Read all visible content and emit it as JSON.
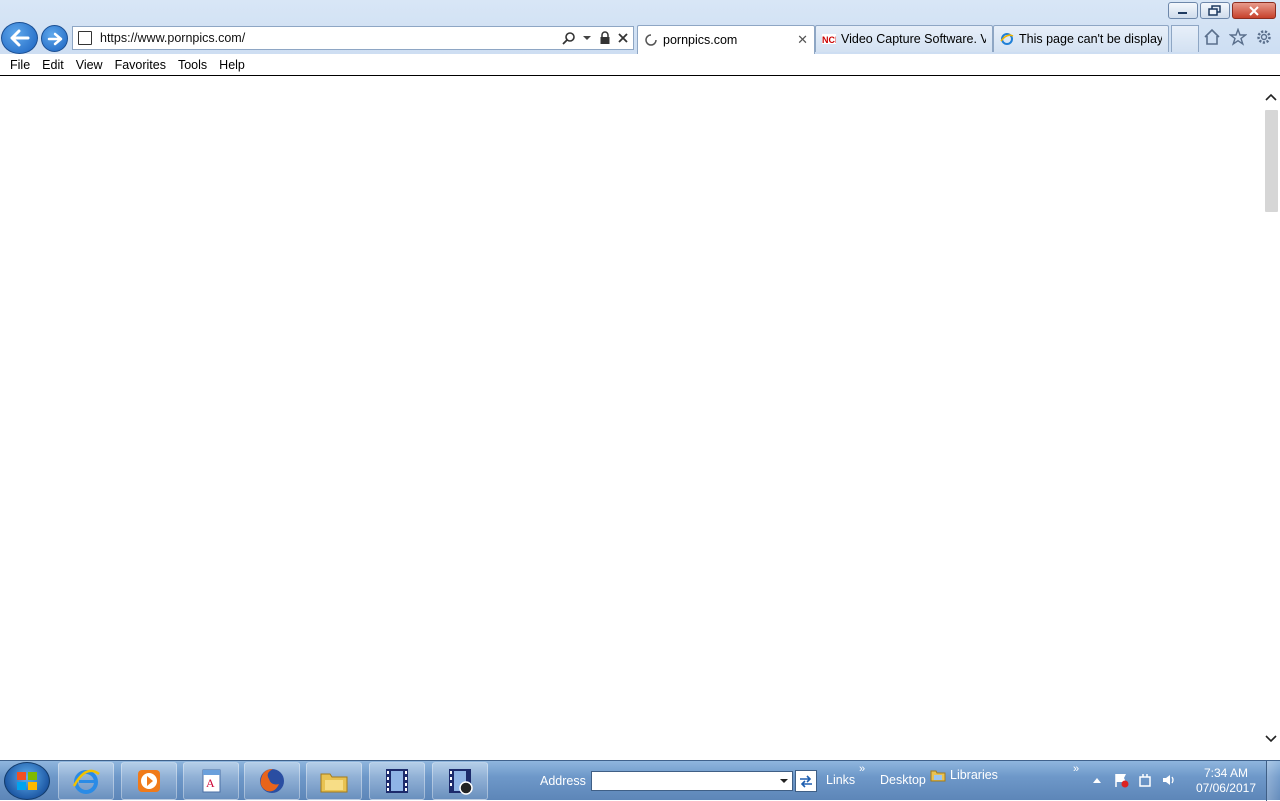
{
  "browser": {
    "url": "https://www.pornpics.com/",
    "tabs": [
      {
        "label": "pornpics.com",
        "active": true,
        "icon": "loading-icon"
      },
      {
        "label": "Video Capture Software. V...",
        "active": false,
        "icon": "nch-icon"
      },
      {
        "label": "This page can't be display...",
        "active": false,
        "icon": "ie-icon"
      }
    ],
    "menu": [
      "File",
      "Edit",
      "View",
      "Favorites",
      "Tools",
      "Help"
    ],
    "toolbar_icons": [
      "home-icon",
      "favorites-star-icon",
      "settings-gear-icon"
    ],
    "window_controls": [
      "minimize",
      "restore",
      "close"
    ]
  },
  "taskbar": {
    "apps": [
      "internet-explorer",
      "media-player",
      "address-book",
      "firefox",
      "file-explorer",
      "video-editor",
      "video-capture"
    ],
    "address_label": "Address",
    "address_value": "",
    "links_label": "Links",
    "desktop_label": "Desktop",
    "libraries_label": "Libraries",
    "more_glyph": "»",
    "clock": {
      "time": "7:34 AM",
      "date": "07/06/2017"
    }
  }
}
